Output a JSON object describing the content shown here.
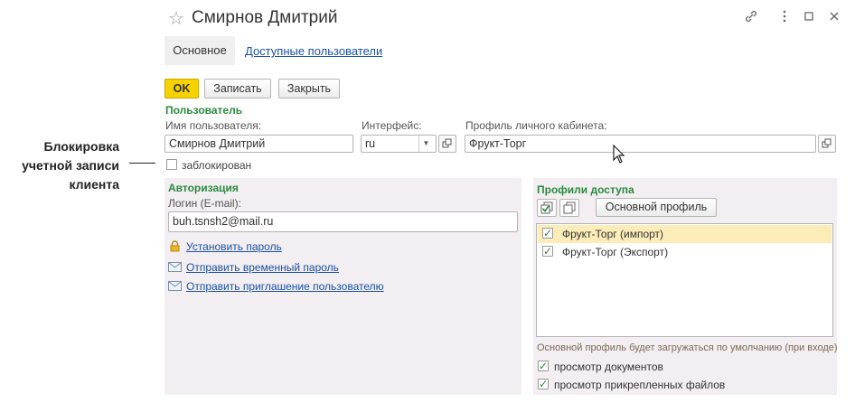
{
  "annotation": {
    "line1": "Блокировка",
    "line2": "учетной записи",
    "line3": "клиента"
  },
  "header": {
    "title": "Смирнов Дмитрий"
  },
  "tabs": [
    {
      "label": "Основное"
    },
    {
      "label": "Доступные пользователи"
    }
  ],
  "toolbar": {
    "ok_label": "OK",
    "save_label": "Записать",
    "close_label": "Закрыть"
  },
  "user": {
    "section_title": "Пользователь",
    "name_label": "Имя пользователя:",
    "name_value": "Смирнов Дмитрий",
    "interface_label": "Интерфейс:",
    "interface_value": "ru",
    "profile_label": "Профиль личного кабинета:",
    "profile_value": "Фрукт-Торг",
    "blocked_label": "заблокирован",
    "blocked": false
  },
  "auth": {
    "section_title": "Авторизация",
    "login_label": "Логин (E-mail):",
    "login_value": "buh.tsnsh2@mail.ru",
    "set_password": "Установить пароль",
    "send_temp_password": "Отправить временный пароль",
    "send_invite": "Отправить приглашение пользователю"
  },
  "access": {
    "section_title": "Профили доступа",
    "main_profile_button": "Основной профиль",
    "profiles": [
      {
        "label": "Фрукт-Торг (импорт)",
        "checked": true,
        "selected": true
      },
      {
        "label": "Фрукт-Торг (Экспорт)",
        "checked": true,
        "selected": false
      }
    ],
    "hint": "Основной профиль будет загружаться по умолчанию (при входе)",
    "view_documents_label": "просмотр документов",
    "view_documents": true,
    "view_files_label": "просмотр прикрепленных файлов",
    "view_files": true
  },
  "colors": {
    "accent_green": "#2b8a3e",
    "ok_yellow": "#f5d200",
    "link_blue": "#1a52a3",
    "panel_bg": "#f2eef1",
    "selected_row": "#fbecb8"
  }
}
